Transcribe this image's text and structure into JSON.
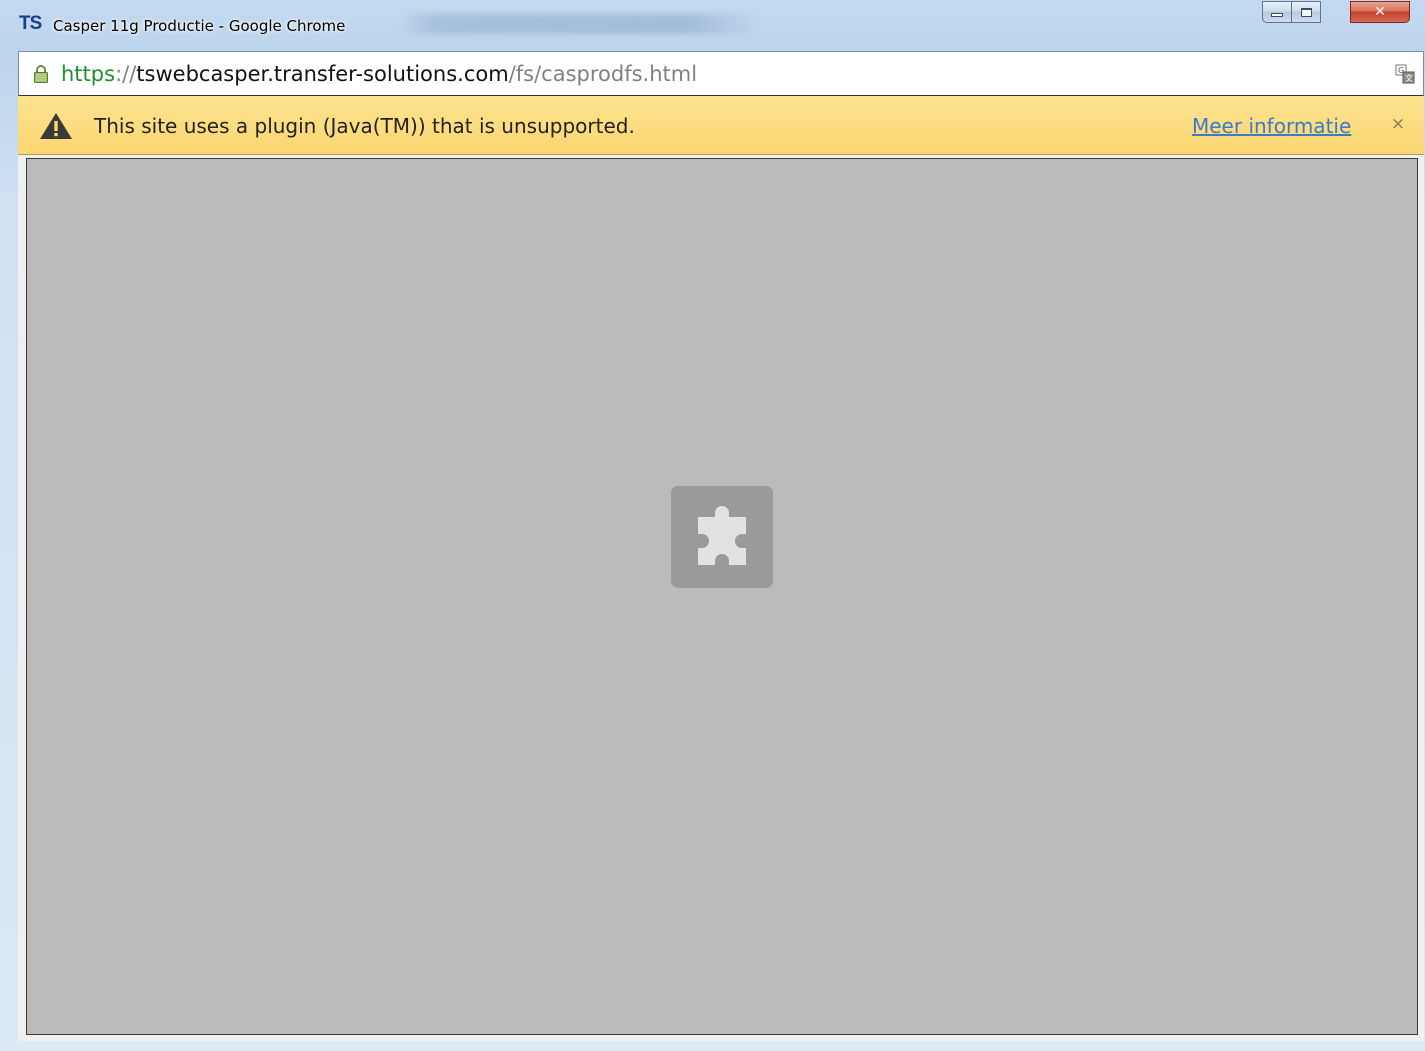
{
  "window": {
    "title": "Casper 11g Productie - Google Chrome",
    "app_icon_text": "TS",
    "controls": {
      "minimize": "",
      "maximize": "",
      "close": "✕"
    }
  },
  "address_bar": {
    "scheme": "https",
    "separator": "://",
    "host": "tswebcasper.transfer-solutions.com",
    "path": "/fs/casprodfs.html",
    "secure": true
  },
  "infobar": {
    "message": "This site uses a plugin (Java(TM)) that is unsupported.",
    "link_label": "Meer informatie",
    "close_glyph": "×",
    "icon": "warning-icon"
  },
  "content": {
    "plugin_placeholder_icon": "puzzle-piece-icon"
  },
  "colors": {
    "infobar_bg": "#fad86b",
    "link": "#3b7bc7",
    "scheme_green": "#1e8f2e",
    "plugin_bg": "#bbbbbb"
  }
}
